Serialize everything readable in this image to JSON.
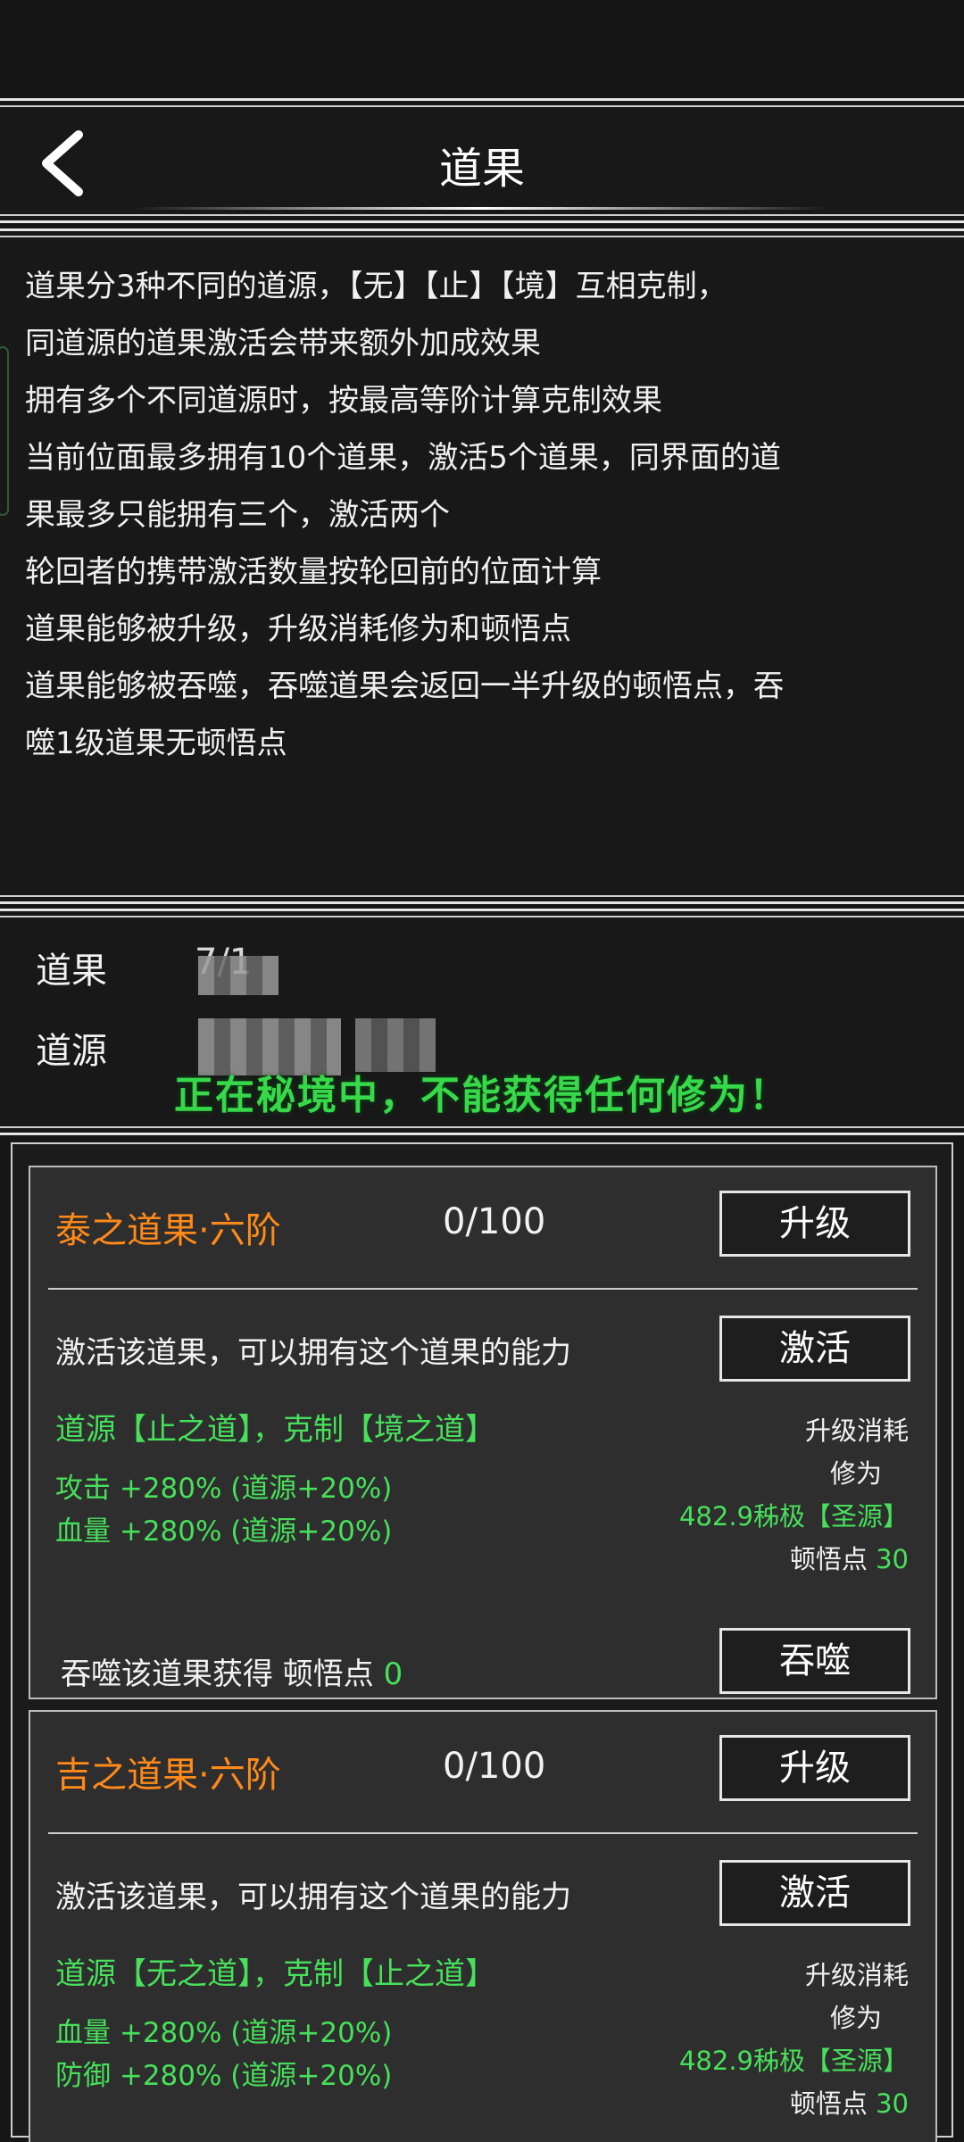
{
  "header": {
    "title": "道果"
  },
  "rules": {
    "lines": [
      "道果分3种不同的道源，【无】【止】【境】互相克制，",
      "同道源的道果激活会带来额外加成效果",
      "拥有多个不同道源时，按最高等阶计算克制效果",
      "当前位面最多拥有10个道果，激活5个道果，同界面的道",
      "果最多只能拥有三个，激活两个",
      "轮回者的携带激活数量按轮回前的位面计算",
      "道果能够被升级，升级消耗修为和顿悟点",
      "道果能够被吞噬，吞噬道果会返回一半升级的顿悟点，吞",
      "噬1级道果无顿悟点"
    ]
  },
  "stats": {
    "dao_fruit_label": "道果",
    "dao_fruit_value": "7/1",
    "dao_source_label": "道源",
    "notice": "正在秘境中，不能获得任何修为！"
  },
  "cards": [
    {
      "name": "泰之道果·六阶",
      "progress": "0/100",
      "upgrade_label": "升级",
      "activate_desc": "激活该道果，可以拥有这个道果的能力",
      "activate_label": "激活",
      "source": "道源【止之道】，克制【境之道】",
      "stat1": "攻击 +280% (道源+20%)",
      "stat2": "血量 +280% (道源+20%)",
      "cost_title": "升级消耗",
      "cost_cultivation_label": "修为",
      "cost_cultivation_value": "482.9秭极【圣源】",
      "cost_insight_label": "顿悟点",
      "cost_insight_value": "30",
      "devour_text": "吞噬该道果获得 顿悟点",
      "devour_value": "0",
      "devour_label": "吞噬"
    },
    {
      "name": "吉之道果·六阶",
      "progress": "0/100",
      "upgrade_label": "升级",
      "activate_desc": "激活该道果，可以拥有这个道果的能力",
      "activate_label": "激活",
      "source": "道源【无之道】，克制【止之道】",
      "stat1": "血量 +280% (道源+20%)",
      "stat2": "防御 +280% (道源+20%)",
      "cost_title": "升级消耗",
      "cost_cultivation_label": "修为",
      "cost_cultivation_value": "482.9秭极【圣源】",
      "cost_insight_label": "顿悟点",
      "cost_insight_value": "30"
    }
  ],
  "colors": {
    "accent_orange": "#ff8a1a",
    "accent_green": "#47e05a",
    "notice_green": "#37d84a"
  }
}
